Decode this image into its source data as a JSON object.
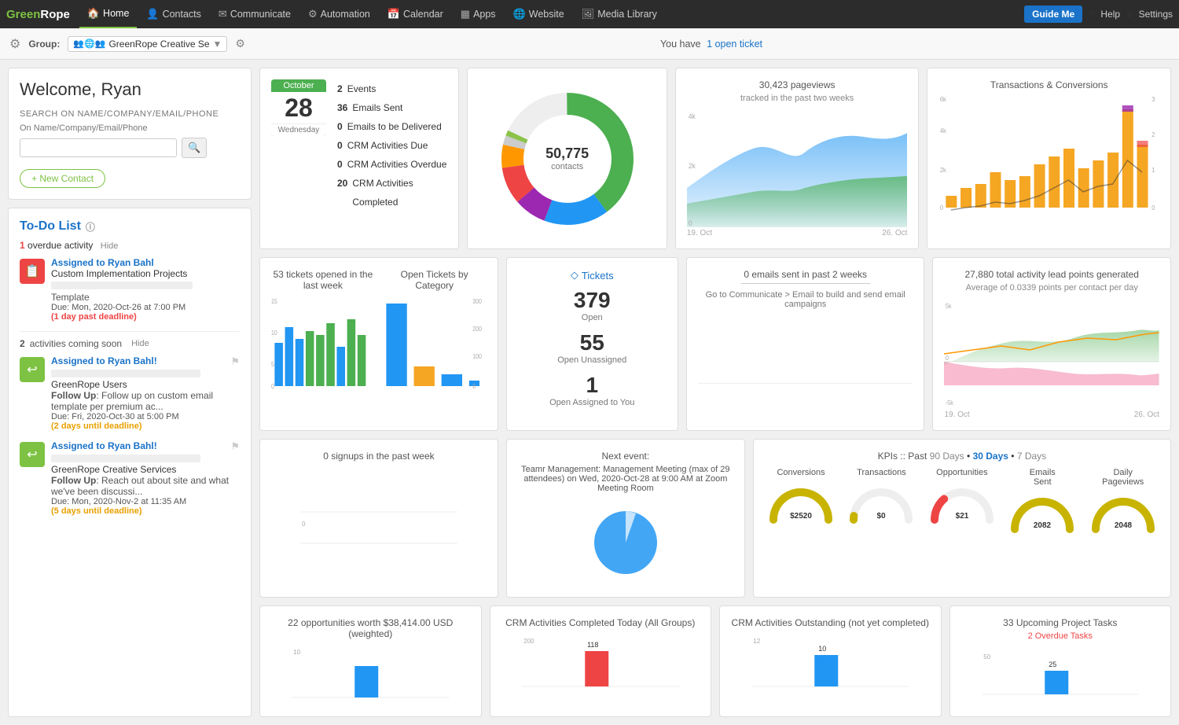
{
  "nav": {
    "logo_green": "Green",
    "logo_rope": "Rope",
    "items": [
      {
        "label": "Home",
        "icon": "🏠",
        "active": true
      },
      {
        "label": "Contacts",
        "icon": "👤"
      },
      {
        "label": "Communicate",
        "icon": "✉"
      },
      {
        "label": "Automation",
        "icon": "⚙"
      },
      {
        "label": "Calendar",
        "icon": "📅"
      },
      {
        "label": "Apps",
        "icon": "▦"
      },
      {
        "label": "Website",
        "icon": "🌐"
      },
      {
        "label": "Media Library",
        "icon": "🖼"
      }
    ],
    "guide_me": "Guide Me",
    "help": "Help",
    "settings": "Settings"
  },
  "toolbar": {
    "group_label": "Group:",
    "group_name": "GreenRope Creative Se",
    "ticket_message": "You have",
    "ticket_count": "1 open ticket"
  },
  "welcome": {
    "title": "Welcome, Ryan",
    "search_label": "SEARCH",
    "search_sublabel": "On Name/Company/Email/Phone",
    "search_placeholder": "",
    "new_contact": "+ New Contact"
  },
  "calendar_events": {
    "month": "October",
    "day": "28",
    "weekday": "Wednesday",
    "events": [
      {
        "num": "2",
        "label": "Events"
      },
      {
        "num": "36",
        "label": "Emails Sent"
      },
      {
        "num": "0",
        "label": "Emails to be Delivered"
      },
      {
        "num": "0",
        "label": "CRM Activities Due"
      },
      {
        "num": "0",
        "label": "CRM Activities Overdue"
      },
      {
        "num": "20",
        "label": "CRM Activities Completed"
      }
    ]
  },
  "contacts_donut": {
    "count": "50,775",
    "label": "contacts"
  },
  "pageviews": {
    "title": "30,423 pageviews",
    "subtitle": "tracked in the past two weeks",
    "x_labels": [
      "19. Oct",
      "26. Oct"
    ],
    "y_labels": [
      "4k",
      "2k",
      "0"
    ]
  },
  "transactions": {
    "title": "Transactions & Conversions",
    "y_left": [
      "6k",
      "4k",
      "2k",
      "0"
    ],
    "y_right": [
      "3",
      "2",
      "1",
      "0"
    ]
  },
  "tickets_bar": {
    "title_left": "53 tickets opened in the last week",
    "title_right": "Open Tickets by Category",
    "y_left": [
      "15",
      "10",
      "5",
      "0"
    ],
    "y_right": [
      "300",
      "200",
      "100",
      "0"
    ]
  },
  "tickets_stats": {
    "link_icon": "◇",
    "link_label": "Tickets",
    "open": {
      "num": "379",
      "label": "Open"
    },
    "unassigned": {
      "num": "55",
      "label": "Open Unassigned"
    },
    "assigned_you": {
      "num": "1",
      "label": "Open Assigned to You"
    }
  },
  "email_stats": {
    "title": "0 emails sent in past 2 weeks",
    "subtitle": "Go to Communicate > Email to build and send email campaigns"
  },
  "lead_points": {
    "title": "27,880 total activity lead points generated",
    "subtitle": "Average of 0.0339 points per contact per day",
    "y_labels": [
      "5k",
      "0",
      "-5k"
    ],
    "x_labels": [
      "19. Oct",
      "26. Oct"
    ]
  },
  "todo": {
    "title": "To-Do List",
    "overdue_count": "1",
    "overdue_label": "overdue activity",
    "hide_label": "Hide",
    "overdue_items": [
      {
        "assigned_to": "Assigned to Ryan Bahl",
        "project": "Custom Implementation Projects",
        "template": "Template",
        "due": "Due: Mon, 2020-Oct-26 at 7:00 PM",
        "deadline_label": "(1 day past deadline)"
      }
    ],
    "coming_soon_count": "2",
    "coming_soon_label": "activities coming soon",
    "coming_soon_hide": "Hide",
    "coming_soon_items": [
      {
        "assigned_to": "Assigned to Ryan Bahl!",
        "group": "GreenRope Users",
        "action": "Follow Up",
        "description": "Follow up on custom email template per premium ac...",
        "due": "Due: Fri, 2020-Oct-30 at 5:00 PM",
        "deadline_label": "(2 days until deadline)"
      },
      {
        "assigned_to": "Assigned to Ryan Bahl!",
        "group": "GreenRope Creative Services",
        "action": "Follow Up",
        "description": "Reach out about site and what we've been discussi...",
        "due": "Due: Mon, 2020-Nov-2 at 11:35 AM",
        "deadline_label": "(5 days until deadline)"
      }
    ]
  },
  "signups": {
    "title": "0 signups in the past week",
    "y_label": "0"
  },
  "next_event": {
    "title": "Next event:",
    "description": "Teamr Management: Management Meeting (max of 29 attendees) on Wed, 2020-Oct-28 at 9:00 AM at Zoom Meeting Room"
  },
  "kpis": {
    "title": "KPIs :: Past",
    "periods": [
      "90 Days",
      "30 Days",
      "7 Days"
    ],
    "active_period": "30 Days",
    "items": [
      {
        "label": "Conversions",
        "value": "$2520",
        "color": "#c8b400",
        "pct": 70
      },
      {
        "label": "Transactions",
        "value": "$0",
        "color": "#c8b400",
        "pct": 5
      },
      {
        "label": "Opportunities",
        "value": "$21",
        "color": "#e44",
        "pct": 15
      },
      {
        "label": "Emails Sent",
        "value": "2082",
        "color": "#c8b400",
        "pct": 75
      },
      {
        "label": "Daily Pageviews",
        "value": "2048",
        "color": "#c8b400",
        "pct": 72
      }
    ]
  },
  "opportunities": {
    "title": "22 opportunities worth $38,414.00 USD (weighted)",
    "y_label": "10"
  },
  "crm_completed": {
    "title": "CRM Activities Completed Today (All Groups)",
    "y_label": "200",
    "bar_value": "118"
  },
  "crm_outstanding": {
    "title": "CRM Activities Outstanding (not yet completed)",
    "y_label": "12",
    "bar_value": "10"
  },
  "project_tasks": {
    "title": "33 Upcoming Project Tasks",
    "subtitle": "2 Overdue Tasks",
    "y_label": "50",
    "bar_value": "25"
  }
}
